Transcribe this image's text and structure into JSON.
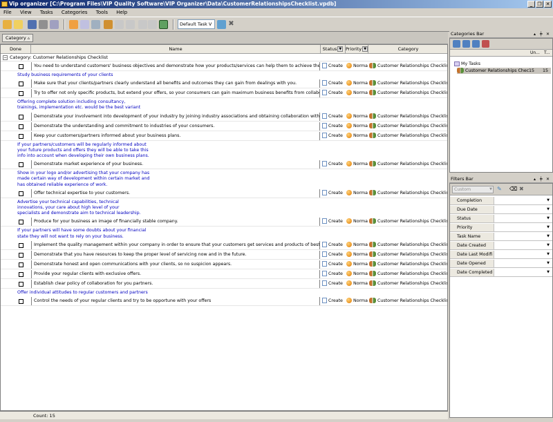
{
  "window": {
    "title": "Vip organizer [C:\\Program Files\\VIP Quality Software\\VIP Organizer\\Data\\CustomerRelationshipsChecklist.vpdb]",
    "minimize": "_",
    "restore": "❐",
    "close": "✕"
  },
  "menu": [
    "File",
    "View",
    "Tasks",
    "Categories",
    "Tools",
    "Help"
  ],
  "toolbar": {
    "task_view_value": "Default Task V",
    "icons": [
      "open-icon",
      "new-folder-icon",
      "save-icon",
      "print-icon",
      "print-preview-icon",
      "new-task-icon",
      "edit-task-icon",
      "link-icon",
      "undo-icon",
      "check-icon",
      "outdent-icon",
      "indent-icon",
      "list-icon",
      "filter-icon",
      "edit-pencil-icon",
      "delete-icon"
    ]
  },
  "group_chip": "Category",
  "grid": {
    "headers": {
      "done": "Done",
      "name": "Name",
      "status": "Status",
      "priority": "Priority",
      "category": "Category"
    },
    "group_label": "Category: Customer Relationships Checklist",
    "status_text": "Create",
    "priority_text": "Norma",
    "category_text": "Customer Relationships Checklist",
    "tasks": [
      "You need to understand customers' business objectives and demonstrate how your products/services can help them to achieve these",
      "Make sure that your clients/partners clearly understand all benefits and outcomes they can gain from dealings with you.",
      "Try to offer not only specific products, but extend your offers, so your consumers can gain maximum business benefits from collaboration",
      "Demonstrate your involvement into development of your industry by joining industry associations and obtaining collaboration with",
      "Demonstrate the understanding and commitment to industries of your consumers.",
      "Keep your customers/partners informed about your business plans.",
      "Demonstrate market experience of your business.",
      "Offer technical expertise to your customers.",
      "Produce for your business an image of financially stable company.",
      "Implement the quality management within your company in order to ensure that your customers get services and products of best quality",
      "Demonstrate that you have resources to keep the proper level of servicing now and in the future.",
      "Demonstrate honest and open communications with your clients, so no suspicion appears.",
      "Provide your regular clients with exclusive offers.",
      "Establish clear policy of collaboration for you partners.",
      "Control the needs of your regular clients and try to be opportune with your offers"
    ],
    "notes": [
      "Study business requirements of your clients",
      "Offering complete solution including consultancy,\ntrainings, implementation etc. would be the best variant",
      "If your partners/customers will be regularly informed about\nyour future products and offers they will be able to take this\ninfo into account when developing their own business plans.",
      "Show in your logo and/or advertising that your company has\nmade certain way of development within certain market and\nhas obtained reliable experience of work.",
      "Advertise your technical capabilities, technical\ninnovations, your care about high level of your\nspecialists and demonstrate aim to technical leadership.",
      "If your partners will have some doubts about your financial\nstate they will not want to rely on your business.",
      "Offer individual attitudes to regular customers and partners"
    ],
    "count": "Count: 15"
  },
  "categories_bar": {
    "title": "Categories Bar",
    "col_unread": "Un...",
    "col_total": "T...",
    "root": "My Tasks",
    "selected": "Customer Relationships Chec",
    "unread": "15",
    "total": "15"
  },
  "filters_bar": {
    "title": "Filters Bar",
    "preset": "Custom",
    "fields": [
      "Completion",
      "Due Date",
      "Status",
      "Priority",
      "Task Name",
      "Date Created",
      "Date Last Modifi",
      "Date Opened",
      "Date Completed"
    ]
  }
}
